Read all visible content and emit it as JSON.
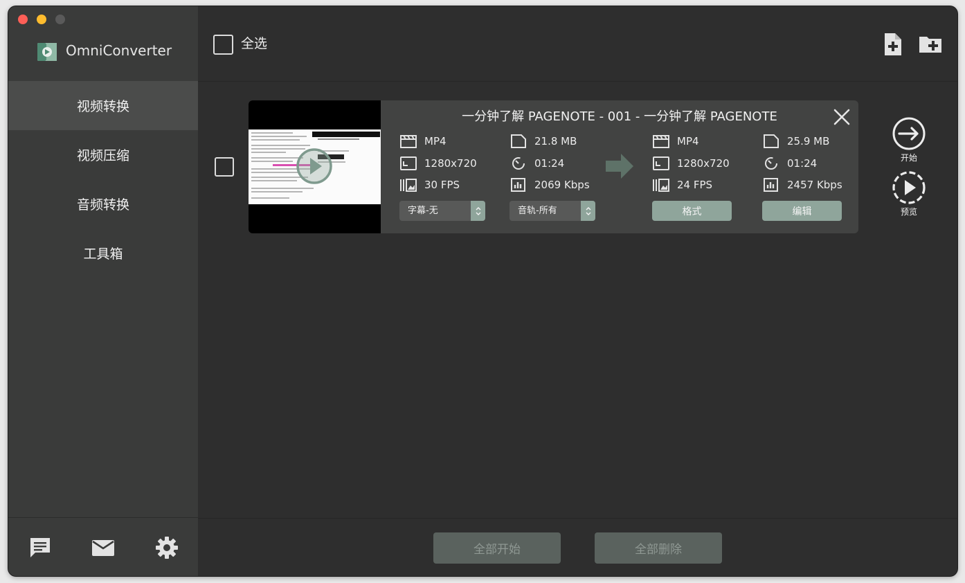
{
  "app": {
    "name": "OmniConverter"
  },
  "sidebar": {
    "items": [
      {
        "label": "视频转换",
        "active": true
      },
      {
        "label": "视频压缩",
        "active": false
      },
      {
        "label": "音频转换",
        "active": false
      },
      {
        "label": "工具箱",
        "active": false
      }
    ],
    "bottom_icons": [
      "chat-icon",
      "mail-icon",
      "gear-icon"
    ]
  },
  "header": {
    "select_all_label": "全选",
    "actions": [
      "add-file-icon",
      "add-folder-icon"
    ]
  },
  "task": {
    "title": "一分钟了解 PAGENOTE - 001 - 一分钟了解 PAGENOTE",
    "source": {
      "format": "MP4",
      "size": "21.8 MB",
      "resolution": "1280x720",
      "duration": "01:24",
      "fps": "30 FPS",
      "bitrate": "2069 Kbps"
    },
    "output": {
      "format": "MP4",
      "size": "25.9 MB",
      "resolution": "1280x720",
      "duration": "01:24",
      "fps": "24 FPS",
      "bitrate": "2457 Kbps"
    },
    "subtitle_select": "字幕-无",
    "audio_select": "音轨-所有",
    "format_button": "格式",
    "edit_button": "编辑",
    "start_label": "开始",
    "preview_label": "预览"
  },
  "footer": {
    "start_all": "全部开始",
    "delete_all": "全部删除"
  },
  "colors": {
    "accent": "#8fa59b",
    "sidebar_bg": "#3a3b3a",
    "main_bg": "#2e2e2e",
    "card_bg": "#424342"
  }
}
